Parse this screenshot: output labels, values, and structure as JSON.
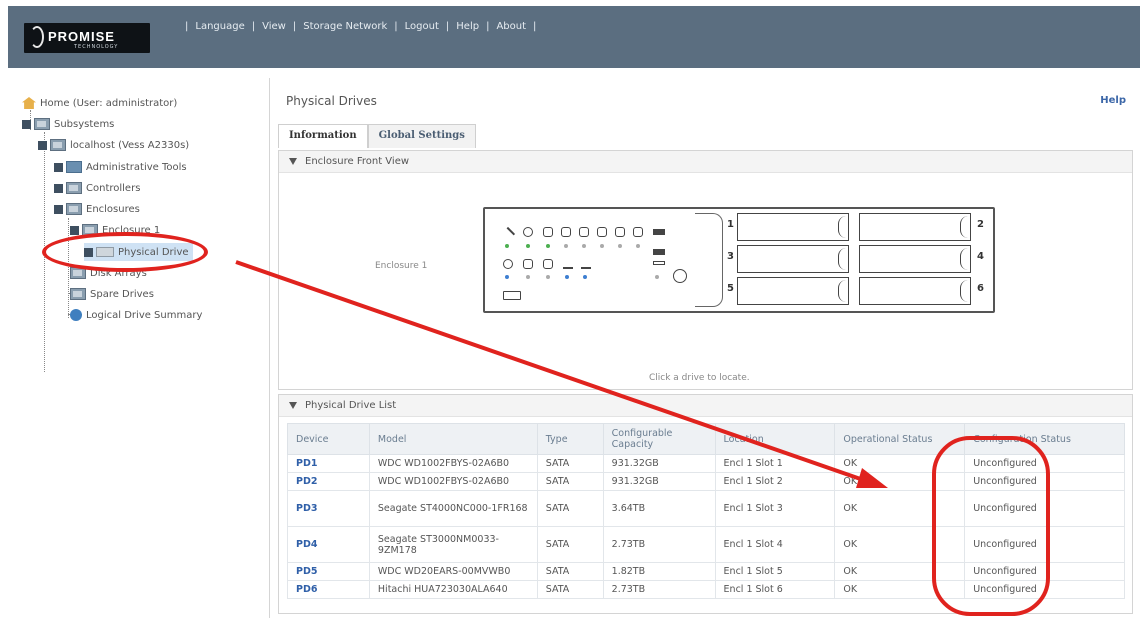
{
  "header": {
    "logo_name": "PROMISE",
    "logo_sub": "TECHNOLOGY",
    "nav": [
      "Language",
      "View",
      "Storage Network",
      "Logout",
      "Help",
      "About"
    ]
  },
  "tree": {
    "home": "Home (User: administrator)",
    "subsystems": "Subsystems",
    "localhost": "localhost (Vess A2330s)",
    "admin_tools": "Administrative Tools",
    "controllers": "Controllers",
    "enclosures": "Enclosures",
    "enclosure1": "Enclosure 1",
    "physical_drive": "Physical Drive",
    "disk_arrays": "Disk Arrays",
    "spare_drives": "Spare Drives",
    "logical_summary": "Logical Drive Summary"
  },
  "main": {
    "title": "Physical Drives",
    "help": "Help",
    "tabs": [
      "Information",
      "Global Settings"
    ],
    "front_view_title": "Enclosure Front View",
    "enclosure_label": "Enclosure 1",
    "locate_hint": "Click a drive to locate.",
    "bay_numbers": [
      "1",
      "2",
      "3",
      "4",
      "5",
      "6"
    ],
    "list_title": "Physical Drive List"
  },
  "table": {
    "headers": [
      "Device",
      "Model",
      "Type",
      "Configurable Capacity",
      "Location",
      "Operational Status",
      "Configuration Status"
    ],
    "rows": [
      [
        "PD1",
        "WDC WD1002FBYS-02A6B0",
        "SATA",
        "931.32GB",
        "Encl 1 Slot 1",
        "OK",
        "Unconfigured"
      ],
      [
        "PD2",
        "WDC WD1002FBYS-02A6B0",
        "SATA",
        "931.32GB",
        "Encl 1 Slot 2",
        "OK",
        "Unconfigured"
      ],
      [
        "PD3",
        "Seagate ST4000NC000-1FR168",
        "SATA",
        "3.64TB",
        "Encl 1 Slot 3",
        "OK",
        "Unconfigured"
      ],
      [
        "PD4",
        "Seagate ST3000NM0033-9ZM178",
        "SATA",
        "2.73TB",
        "Encl 1 Slot 4",
        "OK",
        "Unconfigured"
      ],
      [
        "PD5",
        "WDC WD20EARS-00MVWB0",
        "SATA",
        "1.82TB",
        "Encl 1 Slot 5",
        "OK",
        "Unconfigured"
      ],
      [
        "PD6",
        "Hitachi HUA723030ALA640",
        "SATA",
        "2.73TB",
        "Encl 1 Slot 6",
        "OK",
        "Unconfigured"
      ]
    ]
  },
  "colors": {
    "header_bg": "#5b6e80",
    "annotation_red": "#e0231e",
    "link_blue": "#2f5fa8"
  }
}
